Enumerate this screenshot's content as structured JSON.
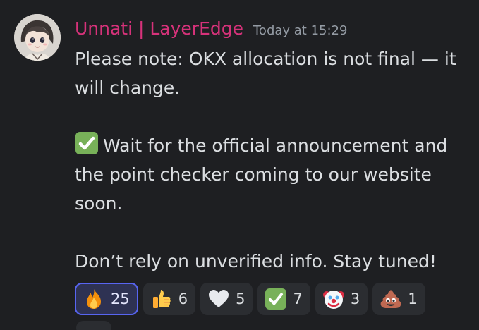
{
  "message": {
    "username": "Unnati | LayerEdge",
    "timestamp": "Today at 15:29",
    "line1": "Please note: OKX allocation is not final — it will change.",
    "line2": "Wait for the official announcement and the point checker coming to our website soon.",
    "line3": "Don’t rely on unverified info. Stay tuned!",
    "emoji_line2": "check-mark-button-icon"
  },
  "reactions": [
    {
      "emoji": "fire-icon",
      "count": "25",
      "active": true
    },
    {
      "emoji": "thumbs-up-icon",
      "count": "6",
      "active": false
    },
    {
      "emoji": "white-heart-icon",
      "count": "5",
      "active": false
    },
    {
      "emoji": "check-mark-button-icon",
      "count": "7",
      "active": false
    },
    {
      "emoji": "clown-face-icon",
      "count": "3",
      "active": false
    },
    {
      "emoji": "pile-of-poo-icon",
      "count": "1",
      "active": false
    }
  ],
  "colors": {
    "background": "#1e1f22",
    "username": "#d6327a",
    "timestamp": "#949ba4",
    "text": "#dbdee1",
    "reaction_bg": "#2b2d31",
    "reaction_active_border": "#5865f2"
  }
}
